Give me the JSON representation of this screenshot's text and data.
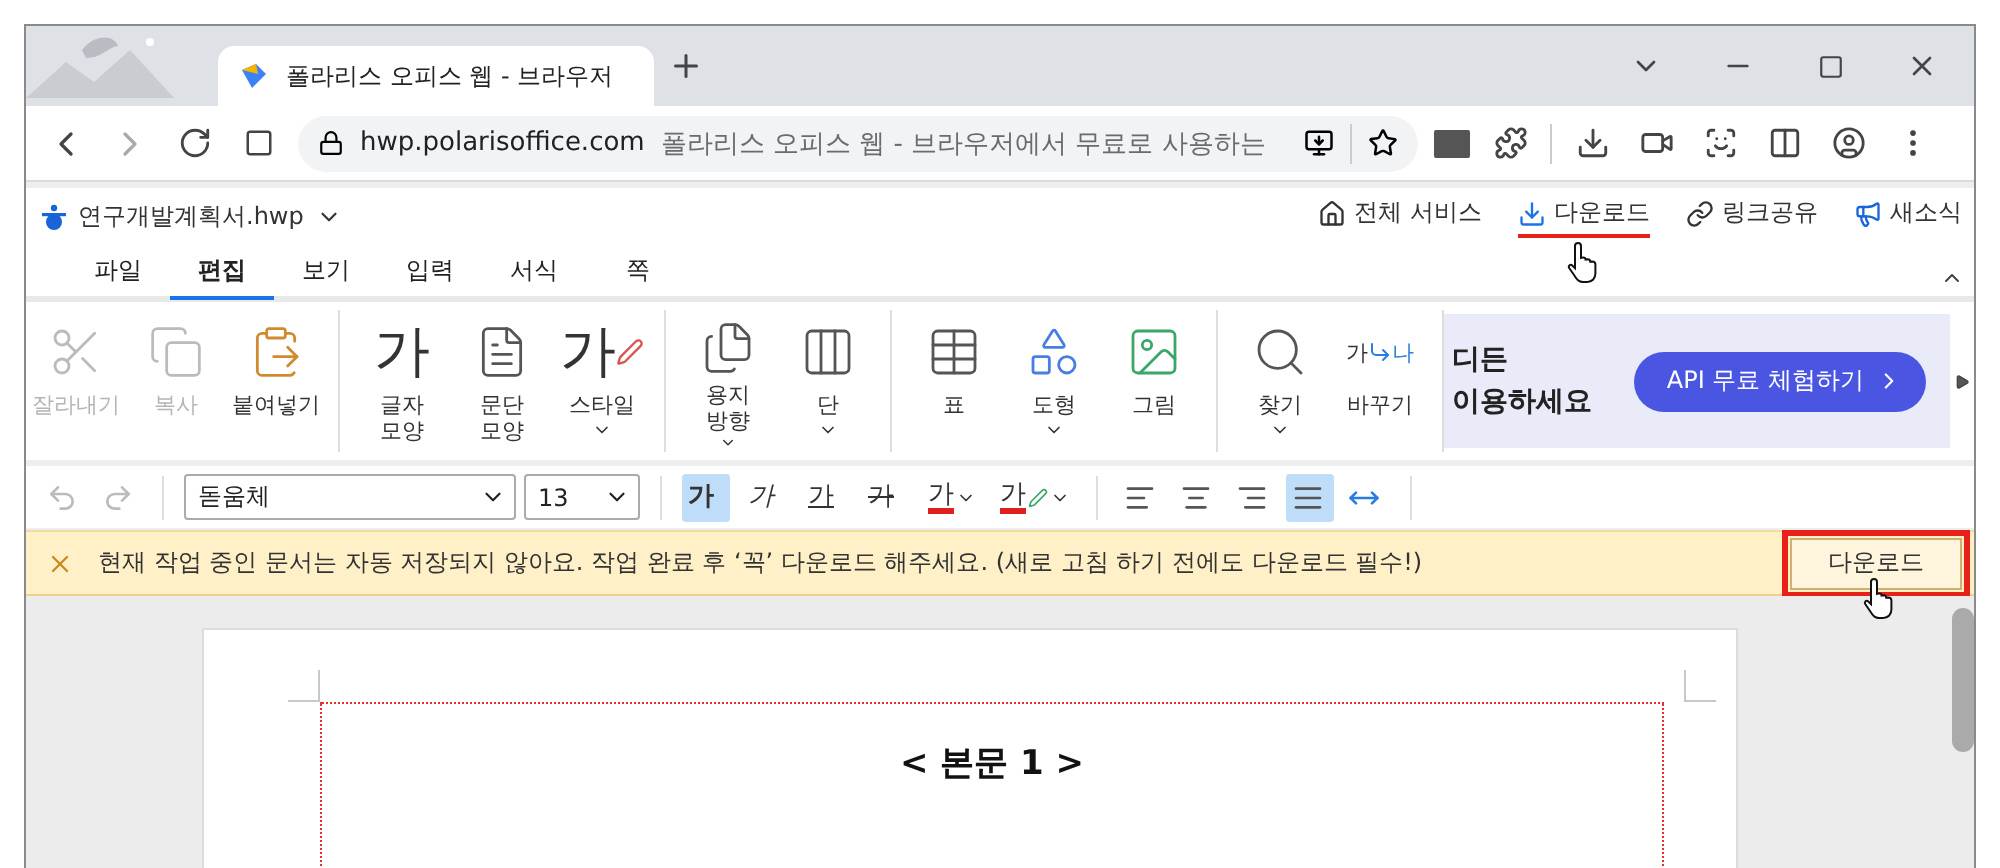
{
  "browser": {
    "tab_title": "폴라리스 오피스 웹 - 브라우저",
    "domain": "hwp.polarisoffice.com",
    "page_title": "폴라리스 오피스 웹 - 브라우저에서 무료로 사용하는"
  },
  "app": {
    "filename": "연구개발계획서.hwp",
    "header_links": [
      {
        "kind": "home",
        "label": "전체 서비스",
        "annotated": false
      },
      {
        "kind": "download",
        "label": "다운로드",
        "annotated": true
      },
      {
        "kind": "link",
        "label": "링크공유",
        "annotated": false
      },
      {
        "kind": "news",
        "label": "새소식",
        "annotated": false
      }
    ]
  },
  "menu_tabs": [
    {
      "label": "파일",
      "selected": false
    },
    {
      "label": "편집",
      "selected": true
    },
    {
      "label": "보기",
      "selected": false
    },
    {
      "label": "입력",
      "selected": false
    },
    {
      "label": "서식",
      "selected": false
    },
    {
      "label": "쪽",
      "selected": false
    }
  ],
  "ribbon": {
    "groups": [
      {
        "tools": [
          {
            "kind": "cut",
            "label": "잘라내기",
            "disabled": true,
            "dropdown": false
          },
          {
            "kind": "copy",
            "label": "복사",
            "disabled": true,
            "dropdown": false
          },
          {
            "kind": "paste",
            "label": "붙여넣기",
            "disabled": false,
            "dropdown": false
          }
        ]
      },
      {
        "tools": [
          {
            "kind": "char",
            "glyph": "가",
            "label": "글자\n모양",
            "disabled": false,
            "dropdown": false
          },
          {
            "kind": "paragraph",
            "label": "문단\n모양",
            "disabled": false,
            "dropdown": false
          },
          {
            "kind": "style",
            "glyph": "가",
            "label": "스타일",
            "disabled": false,
            "dropdown": true
          }
        ]
      },
      {
        "tools": [
          {
            "kind": "orientation",
            "label": "용지\n방향",
            "disabled": false,
            "dropdown": true
          },
          {
            "kind": "columns",
            "label": "단",
            "disabled": false,
            "dropdown": true
          }
        ]
      },
      {
        "tools": [
          {
            "kind": "table",
            "label": "표",
            "disabled": false,
            "dropdown": false
          },
          {
            "kind": "shape",
            "label": "도형",
            "disabled": false,
            "dropdown": true
          },
          {
            "kind": "picture",
            "label": "그림",
            "disabled": false,
            "dropdown": false
          }
        ]
      },
      {
        "tools": [
          {
            "kind": "find",
            "label": "찾기",
            "disabled": false,
            "dropdown": true
          },
          {
            "kind": "replace",
            "glyph": "가",
            "glyph2": "나",
            "label": "바꾸기",
            "disabled": false,
            "dropdown": false
          }
        ]
      }
    ],
    "banner": {
      "lines": [
        "디든",
        "이용하세요"
      ],
      "button": "API 무료 체험하기"
    }
  },
  "format_bar": {
    "font": "돋움체",
    "size": "13",
    "styles": [
      {
        "kind": "bold",
        "glyph": "가",
        "selected": true
      },
      {
        "kind": "italic",
        "glyph": "가",
        "selected": false
      },
      {
        "kind": "underline",
        "glyph": "가",
        "selected": false
      },
      {
        "kind": "strike",
        "glyph": "가",
        "selected": false
      },
      {
        "kind": "color",
        "glyph": "가",
        "selected": false
      },
      {
        "kind": "highlight",
        "glyph": "가",
        "selected": false
      }
    ],
    "align": [
      {
        "kind": "left",
        "selected": false
      },
      {
        "kind": "center",
        "selected": false
      },
      {
        "kind": "right",
        "selected": false
      },
      {
        "kind": "justify",
        "selected": true
      },
      {
        "kind": "distribute",
        "selected": false
      }
    ]
  },
  "notice": {
    "message": "현재 작업 중인 문서는 자동 저장되지 않아요. 작업 완료 후 ‘꼭’ 다운로드 해주세요. (새로 고침 하기 전에도 다운로드 필수!)",
    "button": "다운로드",
    "annotated": true
  },
  "document": {
    "heading": "< 본문 1 >"
  }
}
